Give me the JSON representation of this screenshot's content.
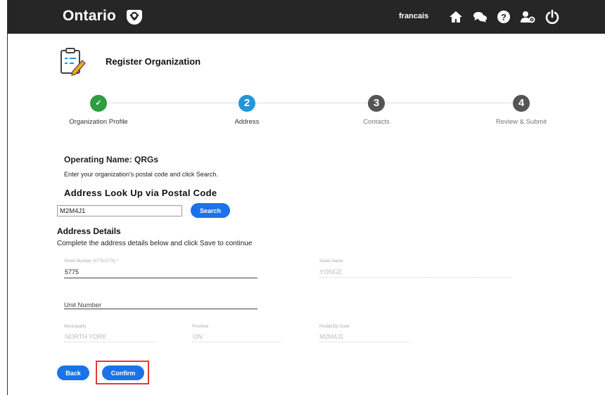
{
  "header": {
    "brand": "Ontario",
    "language_link": "francais",
    "icons": [
      "home-icon",
      "chat-icon",
      "help-icon",
      "user-settings-icon",
      "power-icon"
    ]
  },
  "page": {
    "title": "Register Organization"
  },
  "steps": [
    {
      "number": "✓",
      "label": "Organization Profile",
      "status": "complete"
    },
    {
      "number": "2",
      "label": "Address",
      "status": "active"
    },
    {
      "number": "3",
      "label": "Contacts",
      "status": "pending"
    },
    {
      "number": "4",
      "label": "Review & Submit",
      "status": "pending"
    }
  ],
  "colors": {
    "complete": "#2e9e3f",
    "active": "#2196d9",
    "pending": "#555555",
    "button": "#1a73e8",
    "highlight": "#e53935"
  },
  "operating_name": "Operating Name: QRGs",
  "instruction": "Enter your organization's postal code and click Search.",
  "lookup": {
    "heading": "Address Look Up via Postal Code",
    "postal_value": "M2M4J1",
    "search_label": "Search"
  },
  "details": {
    "heading": "Address Details",
    "subtitle": "Complete the address details below and click Save to continue",
    "street_number": {
      "label": "Street Number (5775-5775) *",
      "value": "5775"
    },
    "street_name": {
      "label": "Street Name",
      "value": "YONGE"
    },
    "unit_number": {
      "label": "Unit Number",
      "value": ""
    },
    "municipality": {
      "label": "Municipality",
      "value": "NORTH YORK"
    },
    "province": {
      "label": "Province",
      "value": "ON"
    },
    "postal_code": {
      "label": "Postal/Zip Code",
      "value": "M2M4J1"
    }
  },
  "actions": {
    "back_label": "Back",
    "confirm_label": "Confirm"
  }
}
